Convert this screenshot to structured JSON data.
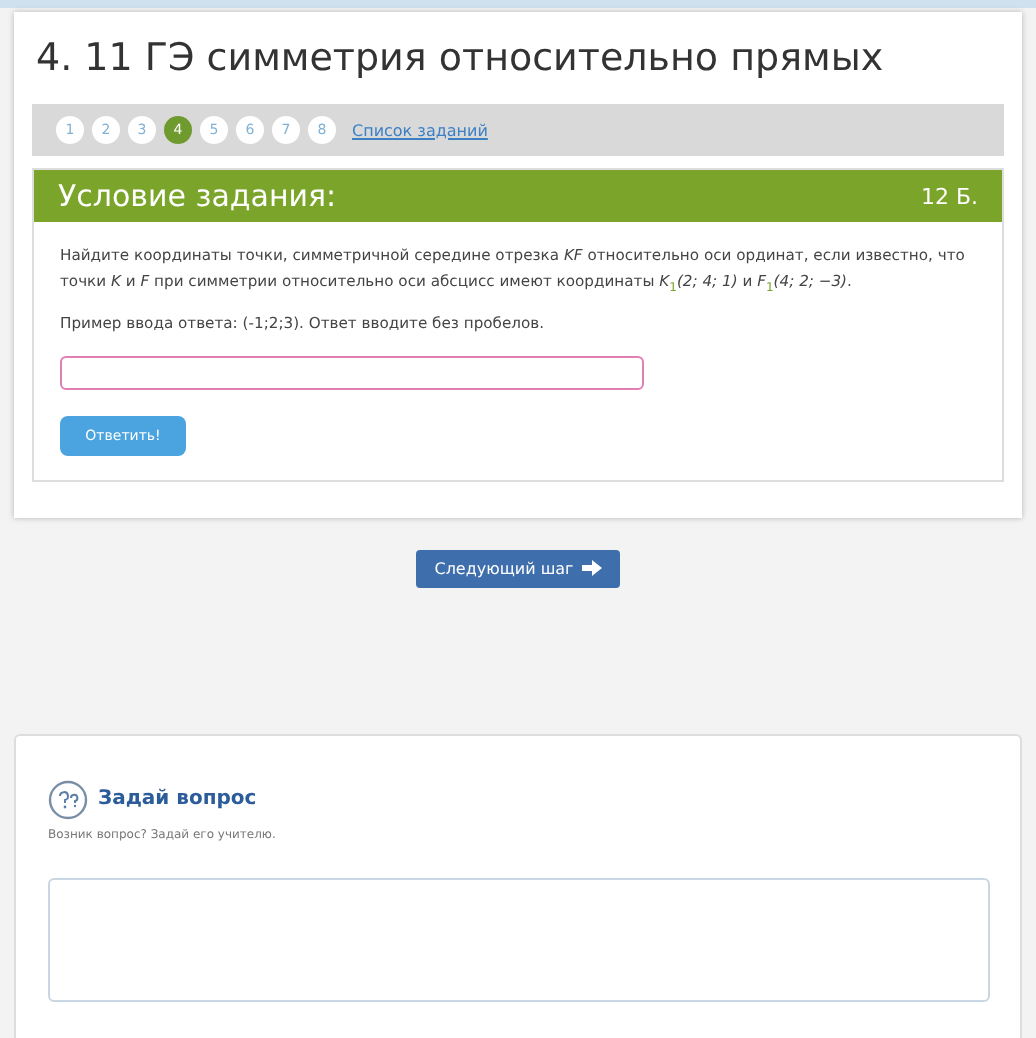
{
  "title": "4. 11 ГЭ симметрия относительно прямых",
  "pager": {
    "steps": [
      {
        "label": "1",
        "selected": false
      },
      {
        "label": "2",
        "selected": false
      },
      {
        "label": "3",
        "selected": false
      },
      {
        "label": "4",
        "selected": true
      },
      {
        "label": "5",
        "selected": false
      },
      {
        "label": "6",
        "selected": false
      },
      {
        "label": "7",
        "selected": false
      },
      {
        "label": "8",
        "selected": false
      }
    ],
    "list_link": "Список заданий"
  },
  "task": {
    "header": "Условие задания:",
    "points": "12 Б.",
    "question": "Найдите координаты точки, симметричной середине отрезка *KF* относительно оси ординат, если известно, что точки *K* и *F* при симметрии относительно оси абсцисс имеют координаты *K*$_{1}$*(2; 4; 1)* и *F*$_{1}$*(4; 2; −3)*.",
    "hint": "Пример ввода ответа: (-1;2;3). Ответ вводите без пробелов.",
    "submit": "Ответить!"
  },
  "next_button": "Следующий шаг",
  "ask": {
    "title": "Задай вопрос",
    "subtitle": "Возник вопрос? Задай его учителю."
  }
}
